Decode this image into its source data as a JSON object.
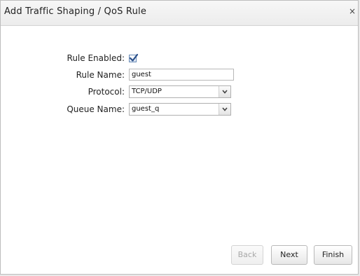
{
  "dialog": {
    "title": "Add Traffic Shaping / QoS Rule",
    "close_glyph": "×"
  },
  "form": {
    "rule_enabled": {
      "label": "Rule Enabled:",
      "checked": true
    },
    "rule_name": {
      "label": "Rule Name:",
      "value": "guest"
    },
    "protocol": {
      "label": "Protocol:",
      "value": "TCP/UDP"
    },
    "queue_name": {
      "label": "Queue Name:",
      "value": "guest_q"
    }
  },
  "buttons": {
    "back": "Back",
    "next": "Next",
    "finish": "Finish"
  },
  "icons": {
    "close": "close-icon",
    "check": "checkmark-icon",
    "dropdown": "chevron-down-icon"
  },
  "colors": {
    "checkbox_border": "#6a8bb6",
    "checkmark": "#2a4f8a"
  }
}
